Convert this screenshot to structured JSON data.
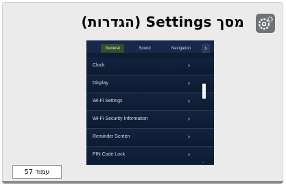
{
  "header": {
    "title": "מסך Settings (הגדרות)",
    "icon": "gear-icon"
  },
  "device_screen": {
    "tabs": [
      {
        "label": "General",
        "active": true
      },
      {
        "label": "Sound",
        "active": false
      },
      {
        "label": "Navigation",
        "active": false
      }
    ],
    "tab_next_icon": "›",
    "items": [
      {
        "label": "Clock",
        "arrow": "›"
      },
      {
        "label": "Display",
        "arrow": "›"
      },
      {
        "label": "Wi-Fi Settings",
        "arrow": "›"
      },
      {
        "label": "Wi-Fi Security Information",
        "arrow": "›"
      },
      {
        "label": "Reminder Screen",
        "arrow": "›"
      },
      {
        "label": "PIN Code Lock",
        "arrow": "›"
      }
    ],
    "scroll_down_icon": "⌄"
  },
  "footer": {
    "page_label": "עמוד 57"
  },
  "colors": {
    "card_bg": "#ebebeb",
    "screen_bg": "#0f1d33",
    "active_tab": "#2e4f2b"
  }
}
